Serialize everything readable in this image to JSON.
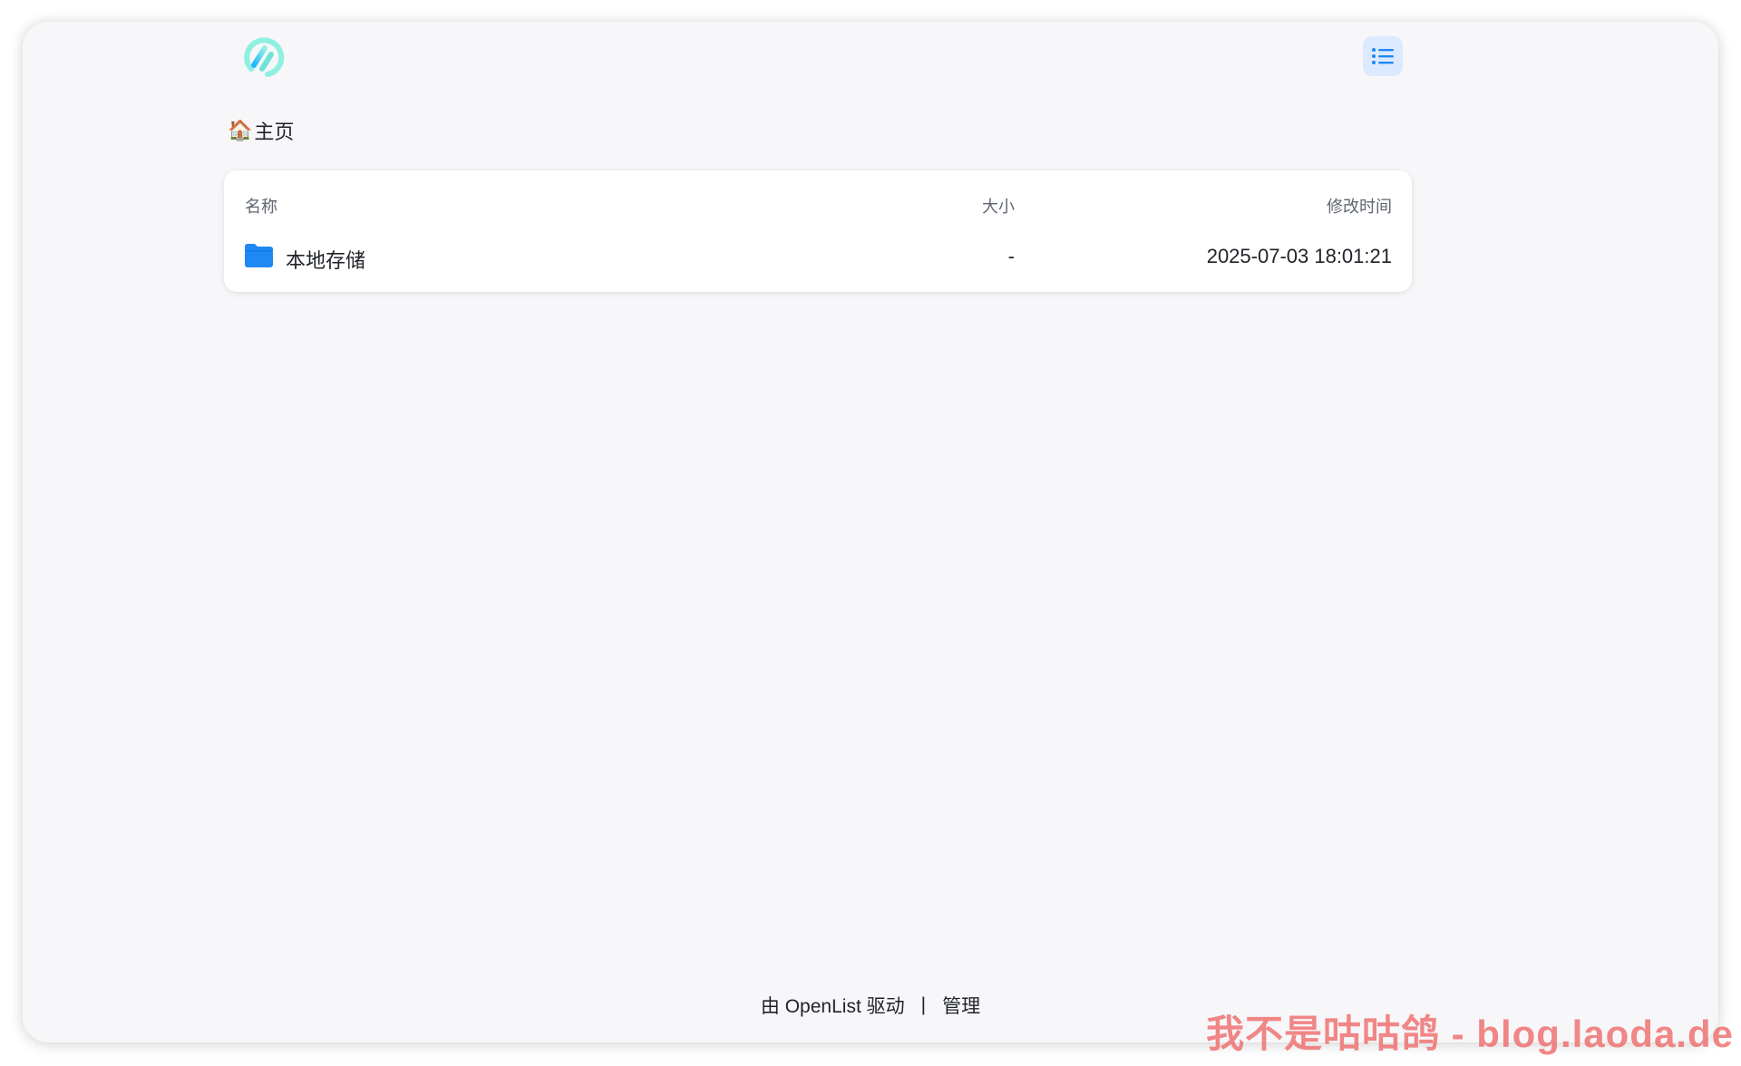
{
  "header": {
    "logo_icon": "openlist-logo-icon",
    "menu_icon": "list-icon"
  },
  "breadcrumb": {
    "home_icon": "🏠",
    "home_label": "主页"
  },
  "table": {
    "columns": {
      "name": "名称",
      "size": "大小",
      "modified": "修改时间"
    },
    "rows": [
      {
        "icon": "folder-icon",
        "name": "本地存储",
        "size": "-",
        "modified": "2025-07-03 18:01:21"
      }
    ]
  },
  "footer": {
    "powered_by": "由 OpenList 驱动",
    "separator": "|",
    "manage": "管理"
  },
  "watermark": "我不是咕咕鸽 - blog.laoda.de",
  "colors": {
    "accent": "#1e88f5",
    "menu_bg": "#dceaff",
    "logo_gradient_start": "#1fb6ff",
    "logo_gradient_end": "#7ff0e0"
  }
}
